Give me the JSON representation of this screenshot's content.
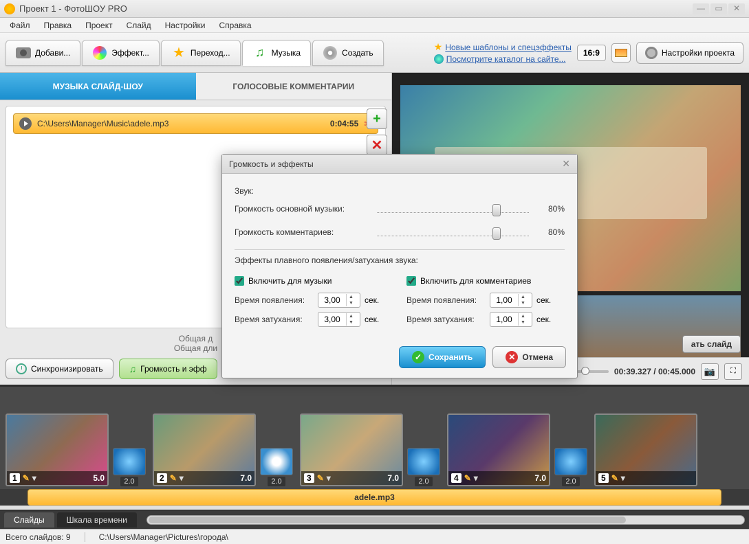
{
  "window": {
    "title": "Проект 1 - ФотоШОУ PRO"
  },
  "menu": {
    "file": "Файл",
    "edit": "Правка",
    "project": "Проект",
    "slide": "Слайд",
    "settings": "Настройки",
    "help": "Справка"
  },
  "toolbar": {
    "add": "Добави...",
    "effects": "Эффект...",
    "transitions": "Переход...",
    "music": "Музыка",
    "create": "Создать",
    "tpl_new": "Новые шаблоны и спецэффекты",
    "tpl_catalog": "Посмотрите каталог на сайте...",
    "aspect": "16:9",
    "settings_label": "Настройки проекта"
  },
  "left": {
    "tab_music": "МУЗЫКА СЛАЙД-ШОУ",
    "tab_voice": "ГОЛОСОВЫЕ КОММЕНТАРИИ",
    "track_path": "C:\\Users\\Manager\\Music\\adele.mp3",
    "track_dur": "0:04:55",
    "info1": "Общая д",
    "info2": "Общая дли",
    "sync": "Синхронизировать",
    "vol_fx": "Громкость и эфф"
  },
  "preview": {
    "edit_slide": "ать слайд",
    "time": "00:39.327 / 00:45.000"
  },
  "dialog": {
    "title": "Громкость и эффекты",
    "sound": "Звук:",
    "vol_music": "Громкость основной музыки:",
    "vol_comment": "Громкость комментариев:",
    "pct": "80%",
    "fx_title": "Эффекты плавного появления/затухания звука:",
    "chk_music": "Включить для музыки",
    "chk_comment": "Включить для комментариев",
    "fade_in": "Время появления:",
    "fade_out": "Время затухания:",
    "v_music_in": "3,00",
    "v_music_out": "3,00",
    "v_comm_in": "1,00",
    "v_comm_out": "1,00",
    "sec": "сек.",
    "save": "Сохранить",
    "cancel": "Отмена"
  },
  "timeline": {
    "music_label": "adele.mp3",
    "slides": [
      {
        "num": "1",
        "dur": "5.0",
        "trans": "2.0"
      },
      {
        "num": "2",
        "dur": "7.0",
        "trans": "2.0"
      },
      {
        "num": "3",
        "dur": "7.0",
        "trans": "2.0"
      },
      {
        "num": "4",
        "dur": "7.0",
        "trans": "2.0"
      },
      {
        "num": "5",
        "dur": "",
        "trans": ""
      }
    ]
  },
  "bottom_tabs": {
    "slides": "Слайды",
    "timeline": "Шкала времени"
  },
  "status": {
    "total": "Всего слайдов: 9",
    "path": "C:\\Users\\Manager\\Pictures\\города\\"
  }
}
